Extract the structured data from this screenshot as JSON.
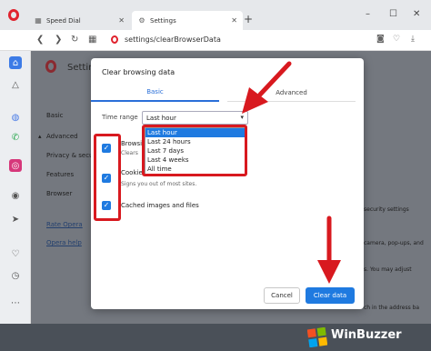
{
  "tabs": [
    {
      "label": "Speed Dial",
      "icon": "grid-icon"
    },
    {
      "label": "Settings",
      "icon": "gear-icon"
    }
  ],
  "new_tab_glyph": "+",
  "window_controls": [
    "–",
    "☐",
    "✕"
  ],
  "address": {
    "url": "settings/clearBrowserData"
  },
  "settings_page": {
    "title": "Settings",
    "nav": [
      "Basic",
      "Advanced",
      "Privacy & secu",
      "Features",
      "Browser"
    ],
    "links": [
      "Rate Opera",
      "Opera help"
    ],
    "right_fragments": [
      "security settings",
      "camera, pop-ups, and",
      "s. You may adjust",
      "ch in the address ba"
    ]
  },
  "dialog": {
    "title": "Clear browsing data",
    "tabs": [
      "Basic",
      "Advanced"
    ],
    "time_range_label": "Time range",
    "time_range_value": "Last hour",
    "dropdown_options": [
      "Last hour",
      "Last 24 hours",
      "Last 7 days",
      "Last 4 weeks",
      "All time"
    ],
    "items": [
      {
        "title": "Browsi",
        "subtitle": "Clears",
        "checked": true
      },
      {
        "title": "Cookie",
        "subtitle": "Signs you out of most sites.",
        "checked": true
      },
      {
        "title": "Cached images and files",
        "subtitle": "",
        "checked": true
      }
    ],
    "cancel_label": "Cancel",
    "clear_label": "Clear data"
  },
  "watermark": {
    "text": "WinBuzzer"
  },
  "colors": {
    "accent": "#1f7ae0",
    "annotation_red": "#d8191f",
    "opera_red": "#e0232e"
  }
}
